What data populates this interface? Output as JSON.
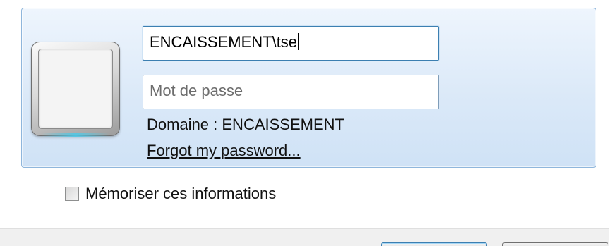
{
  "credential": {
    "username_value": "ENCAISSEMENT\\tse",
    "password_placeholder": "Mot de passe",
    "domain_text": "Domaine : ENCAISSEMENT",
    "forgot_link": "Forgot my password..."
  },
  "options": {
    "remember_label": "Mémoriser ces informations",
    "remember_checked": false
  },
  "colors": {
    "tile_border": "#8fb6dc",
    "tile_background": "#dbe9f8",
    "focus_border": "#3c7fb1"
  },
  "icons": {
    "avatar": "user-tile-icon"
  }
}
